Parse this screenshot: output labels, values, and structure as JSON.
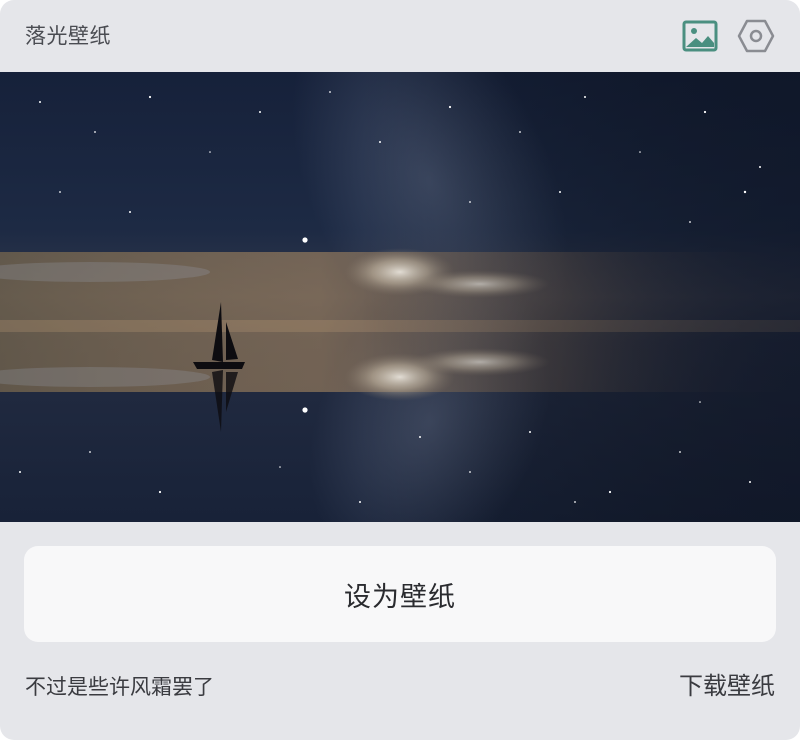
{
  "app": {
    "title": "落光壁纸"
  },
  "toolbar": {
    "gallery_icon": "image-icon",
    "settings_icon": "hexagon-settings-icon",
    "accent": "#4a8f80",
    "icon_gray": "#8a8c92"
  },
  "wallpaper": {
    "subject": "sailboat-on-reflective-sea-under-starry-night-sky"
  },
  "actions": {
    "set_wallpaper": "设为壁纸",
    "download": "下载壁纸"
  },
  "quote": {
    "text": "不过是些许风霜罢了"
  }
}
